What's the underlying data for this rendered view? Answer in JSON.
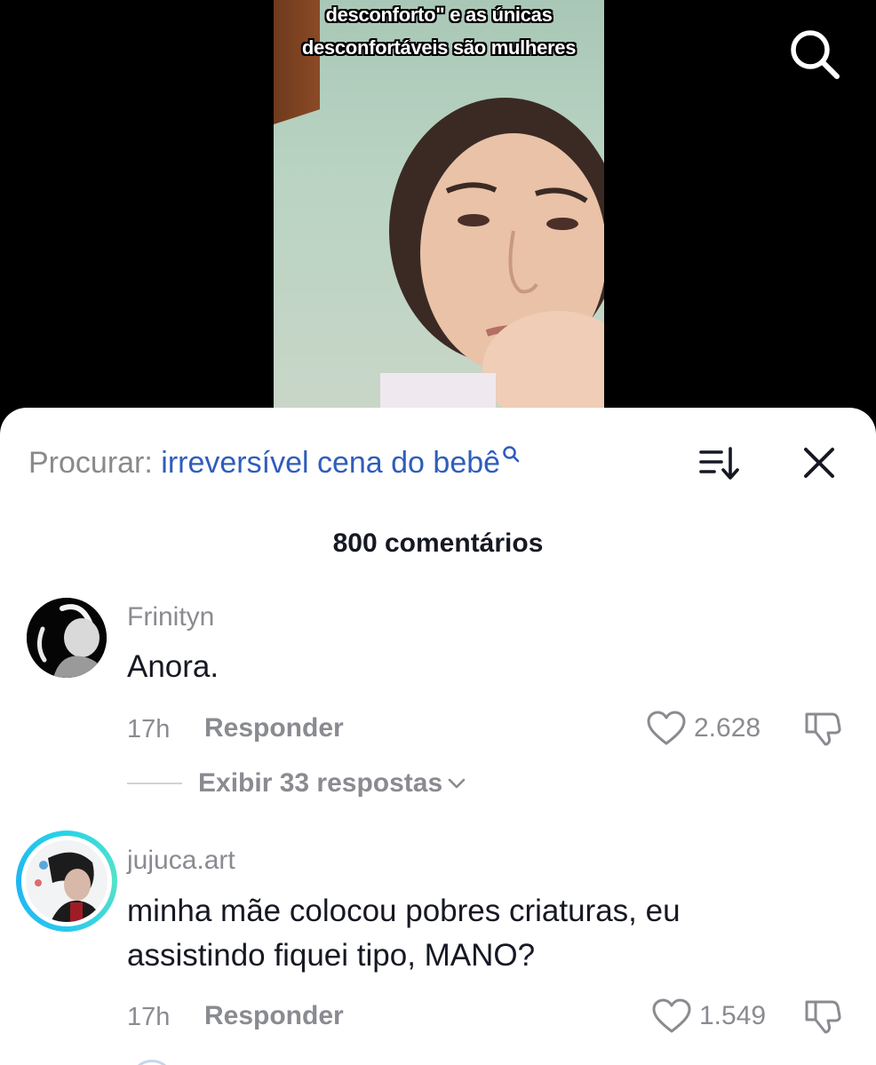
{
  "video": {
    "caption_line1": "desconforto\" e as únicas",
    "caption_line2": "desconfortáveis são mulheres"
  },
  "top_bar": {
    "search_icon": "search-icon"
  },
  "comments_sheet": {
    "search_prefix": "Procurar:",
    "search_term": "irreversível cena do bebê",
    "sort_icon": "sort-icon",
    "close_icon": "close-icon",
    "count_label": "800 comentários",
    "comments": [
      {
        "username": "Frinityn",
        "text": "Anora.",
        "time": "17h",
        "reply_label": "Responder",
        "likes": "2.628",
        "view_replies": "Exibir 33 respostas"
      },
      {
        "username": "jujuca.art",
        "text": "minha mãe colocou pobres criaturas, eu assistindo fiquei tipo, MANO?",
        "time": "17h",
        "reply_label": "Responder",
        "likes": "1.549"
      }
    ]
  },
  "colors": {
    "accent_search": "#2f5dbc",
    "muted_text": "#8a8b91",
    "primary_text": "#161823",
    "story_ring": "#29d4e6"
  }
}
